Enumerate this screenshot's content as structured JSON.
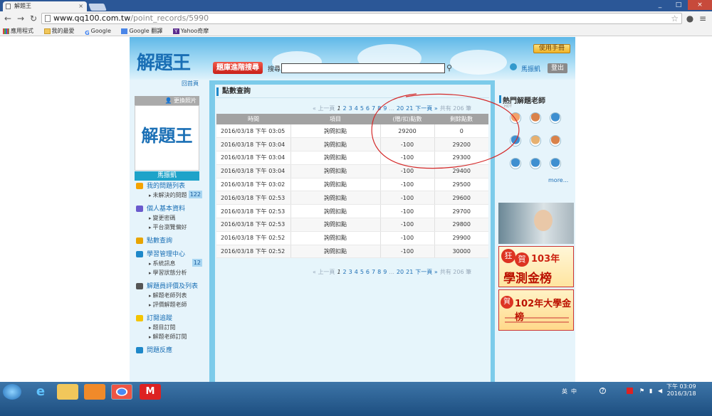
{
  "browser": {
    "tab_title": "解題王",
    "tab_close": "×",
    "url_host": "www.qq100.com.tw",
    "url_path": "/point_records/5990",
    "bookmarks": [
      "應用程式",
      "我的最愛",
      "Google",
      "Google 翻譯",
      "Yahoo奇摩"
    ],
    "win_controls": [
      "_",
      "□",
      "×"
    ]
  },
  "header": {
    "logo_text": "解題王",
    "home_label": "回首頁",
    "manual_label": "使用手冊",
    "search_button": "題庫進階搜尋",
    "search_label": "搜尋",
    "search_value": "",
    "user_name": "馬振凱",
    "logout_label": "登出"
  },
  "sidebar": {
    "change_pic": "更換照片",
    "avatar_text": "解題王",
    "name": "馬振凱",
    "sections": [
      {
        "label": "我的問題列表",
        "icon": "chat-icon",
        "items": [
          {
            "label": "未解決的問題",
            "count": "122"
          }
        ]
      },
      {
        "label": "個人基本資料",
        "icon": "person-icon",
        "items": [
          {
            "label": "變更密碼",
            "count": ""
          },
          {
            "label": "平台瀏覽偏好",
            "count": ""
          }
        ]
      },
      {
        "label": "點數查詢",
        "icon": "coins-icon",
        "items": []
      },
      {
        "label": "學習管理中心",
        "icon": "book-icon",
        "items": [
          {
            "label": "系統訊息",
            "count": "12"
          },
          {
            "label": "學習狀態分析",
            "count": ""
          }
        ]
      },
      {
        "label": "解題員評價及列表",
        "icon": "list-icon",
        "items": [
          {
            "label": "解題老師列表",
            "count": ""
          },
          {
            "label": "評價解題老師",
            "count": ""
          }
        ]
      },
      {
        "label": "訂閱追蹤",
        "icon": "bulb-icon",
        "items": [
          {
            "label": "題目訂閱",
            "count": ""
          },
          {
            "label": "解題老師訂閱",
            "count": ""
          }
        ]
      },
      {
        "label": "問題反應",
        "icon": "help-icon",
        "items": []
      }
    ]
  },
  "main": {
    "title": "點數查詢",
    "pager": {
      "prev": "« 上一頁",
      "current": "1",
      "pages": [
        "2",
        "3",
        "4",
        "5",
        "6",
        "7",
        "8",
        "9"
      ],
      "ellipsis": "...",
      "tail": [
        "20",
        "21"
      ],
      "next": "下一頁 »",
      "total": "共有 206 筆"
    },
    "columns": [
      "時間",
      "項目",
      "(贈/扣)點數",
      "剩餘點數"
    ],
    "rows": [
      {
        "time": "2016/03/18 下午 03:05",
        "item": "詢問扣點",
        "change": "29200",
        "balance": "0"
      },
      {
        "time": "2016/03/18 下午 03:04",
        "item": "詢問扣點",
        "change": "-100",
        "balance": "29200"
      },
      {
        "time": "2016/03/18 下午 03:04",
        "item": "詢問扣點",
        "change": "-100",
        "balance": "29300"
      },
      {
        "time": "2016/03/18 下午 03:04",
        "item": "詢問扣點",
        "change": "-100",
        "balance": "29400"
      },
      {
        "time": "2016/03/18 下午 03:02",
        "item": "詢問扣點",
        "change": "-100",
        "balance": "29500"
      },
      {
        "time": "2016/03/18 下午 02:53",
        "item": "詢問扣點",
        "change": "-100",
        "balance": "29600"
      },
      {
        "time": "2016/03/18 下午 02:53",
        "item": "詢問扣點",
        "change": "-100",
        "balance": "29700"
      },
      {
        "time": "2016/03/18 下午 02:53",
        "item": "詢問扣點",
        "change": "-100",
        "balance": "29800"
      },
      {
        "time": "2016/03/18 下午 02:52",
        "item": "詢問扣點",
        "change": "-100",
        "balance": "29900"
      },
      {
        "time": "2016/03/18 下午 02:52",
        "item": "詢問扣點",
        "change": "-100",
        "balance": "30000"
      }
    ]
  },
  "right": {
    "title": "熱門解題老師",
    "hot": "HOT",
    "more": "more...",
    "ad1": "",
    "ad2_main": "學測金榜",
    "ad2_top": "103年",
    "ad2_badge1": "狂",
    "ad2_badge2": "賀",
    "ad3_main": "102年大學金榜",
    "ad3_badge": "賀"
  },
  "taskbar": {
    "time": "下午 03:09",
    "date": "2016/3/18",
    "tray": [
      "英",
      "中"
    ]
  }
}
